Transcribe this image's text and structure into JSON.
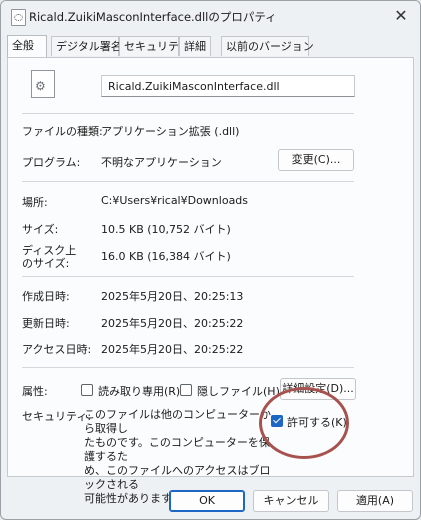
{
  "window": {
    "title": "Ricald.ZuikiMasconInterface.dllのプロパティ",
    "close_glyph": "✕"
  },
  "tabs": [
    {
      "label": "全般",
      "active": true
    },
    {
      "label": "デジタル署名"
    },
    {
      "label": "セキュリティ"
    },
    {
      "label": "詳細"
    },
    {
      "label": "以前のバージョン"
    }
  ],
  "general": {
    "file_name": "Ricald.ZuikiMasconInterface.dll",
    "file_type_label": "ファイルの種類:",
    "file_type_value": "アプリケーション拡張 (.dll)",
    "program_label": "プログラム:",
    "program_value": "不明なアプリケーション",
    "change_button": "変更(C)...",
    "location_label": "場所:",
    "location_value": "C:¥Users¥rical¥Downloads",
    "size_label": "サイズ:",
    "size_value": "10.5 KB (10,752 バイト)",
    "disk_size_label_1": "ディスク上",
    "disk_size_label_2": "のサイズ:",
    "disk_size_value": "16.0 KB (16,384 バイト)",
    "created_label": "作成日時:",
    "created_value": "2025年5月20日、20:25:13",
    "modified_label": "更新日時:",
    "modified_value": "2025年5月20日、20:25:22",
    "accessed_label": "アクセス日時:",
    "accessed_value": "2025年5月20日、20:25:22",
    "attributes_label": "属性:",
    "readonly_label": "読み取り専用(R)",
    "readonly_checked": false,
    "hidden_label": "隠しファイル(H)",
    "hidden_checked": false,
    "advanced_button": "詳細設定(D)...",
    "security_label": "セキュリティ:",
    "security_warning_lines": [
      "このファイルは他のコンピューターから取得し",
      "たものです。このコンピューターを保護するた",
      "め、このファイルへのアクセスはブロックされる",
      "可能性があります。"
    ],
    "unblock_label": "許可する(K)",
    "unblock_checked": true
  },
  "footer": {
    "ok": "OK",
    "cancel": "キャンセル",
    "apply": "適用(A)"
  },
  "colors": {
    "accent": "#1d66c4",
    "annotation_circle": "#a8524f"
  }
}
